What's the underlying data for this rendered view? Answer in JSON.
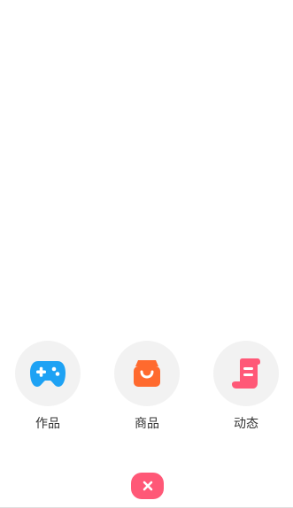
{
  "menu": {
    "items": [
      {
        "label": "作品",
        "icon": "gamepad-icon",
        "color": "#1ea2f4"
      },
      {
        "label": "商品",
        "icon": "shopping-bag-icon",
        "color": "#ff6a2e"
      },
      {
        "label": "动态",
        "icon": "scroll-icon",
        "color": "#ff5877"
      }
    ]
  },
  "close_button": {
    "icon": "close-icon",
    "color": "#ff5877"
  }
}
